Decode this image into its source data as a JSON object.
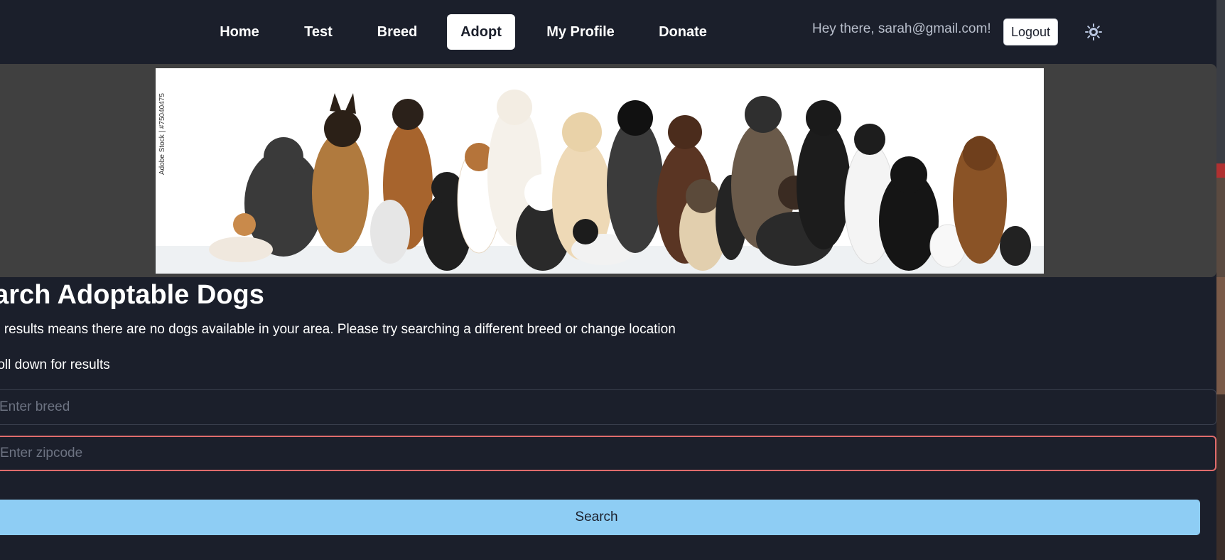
{
  "nav": {
    "links": [
      {
        "label": "Home"
      },
      {
        "label": "Test"
      },
      {
        "label": "Breed"
      },
      {
        "label": "Adopt"
      },
      {
        "label": "My Profile"
      },
      {
        "label": "Donate"
      }
    ],
    "active": "Adopt",
    "greeting": "Hey there, sarah@gmail.com!",
    "logout_label": "Logout",
    "theme_icon": "sun-icon"
  },
  "banner": {
    "watermark": "Adobe Stock | #75040475"
  },
  "search": {
    "heading": "earch Adoptable Dogs",
    "info": "o results means there are no dogs available in your area. Please try searching a different breed or change location",
    "scroll_hint": "roll down for results",
    "breed_placeholder": "Enter breed",
    "zipcode_placeholder": "Enter zipcode",
    "button_label": "Search"
  },
  "colors": {
    "background": "#1b1f2b",
    "banner_band": "#404040",
    "search_button": "#8ecdf4",
    "invalid_border": "#e06c6c"
  }
}
